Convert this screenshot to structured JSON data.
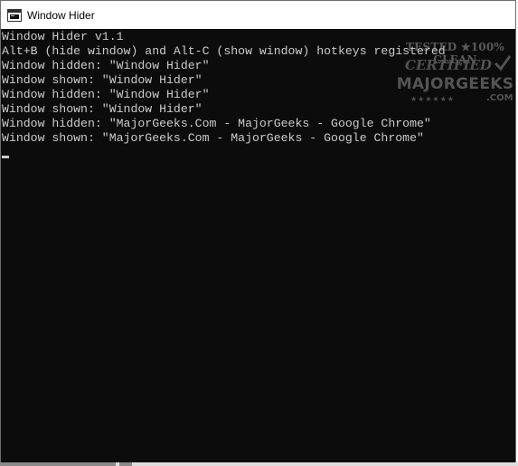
{
  "window": {
    "title": "Window Hider",
    "icon": "window-hider-app-icon"
  },
  "console": {
    "lines": [
      "Window Hider v1.1",
      "Alt+B (hide window) and Alt-C (show window) hotkeys registered",
      "Window hidden: \"Window Hider\"",
      "Window shown: \"Window Hider\"",
      "Window hidden: \"Window Hider\"",
      "Window shown: \"Window Hider\"",
      "Window hidden: \"MajorGeeks.Com - MajorGeeks - Google Chrome\"",
      "Window shown: \"MajorGeeks.Com - MajorGeeks - Google Chrome\""
    ],
    "text_color": "#cccccc",
    "background_color": "#0c0c0c"
  },
  "watermark": {
    "top_text": "TESTED ★100% CLEAN",
    "certified_text": "CERTIFIED",
    "brand_text": "MAJORGEEKS",
    "stars_text": "★★★★★★",
    "domain_text": ".COM"
  }
}
